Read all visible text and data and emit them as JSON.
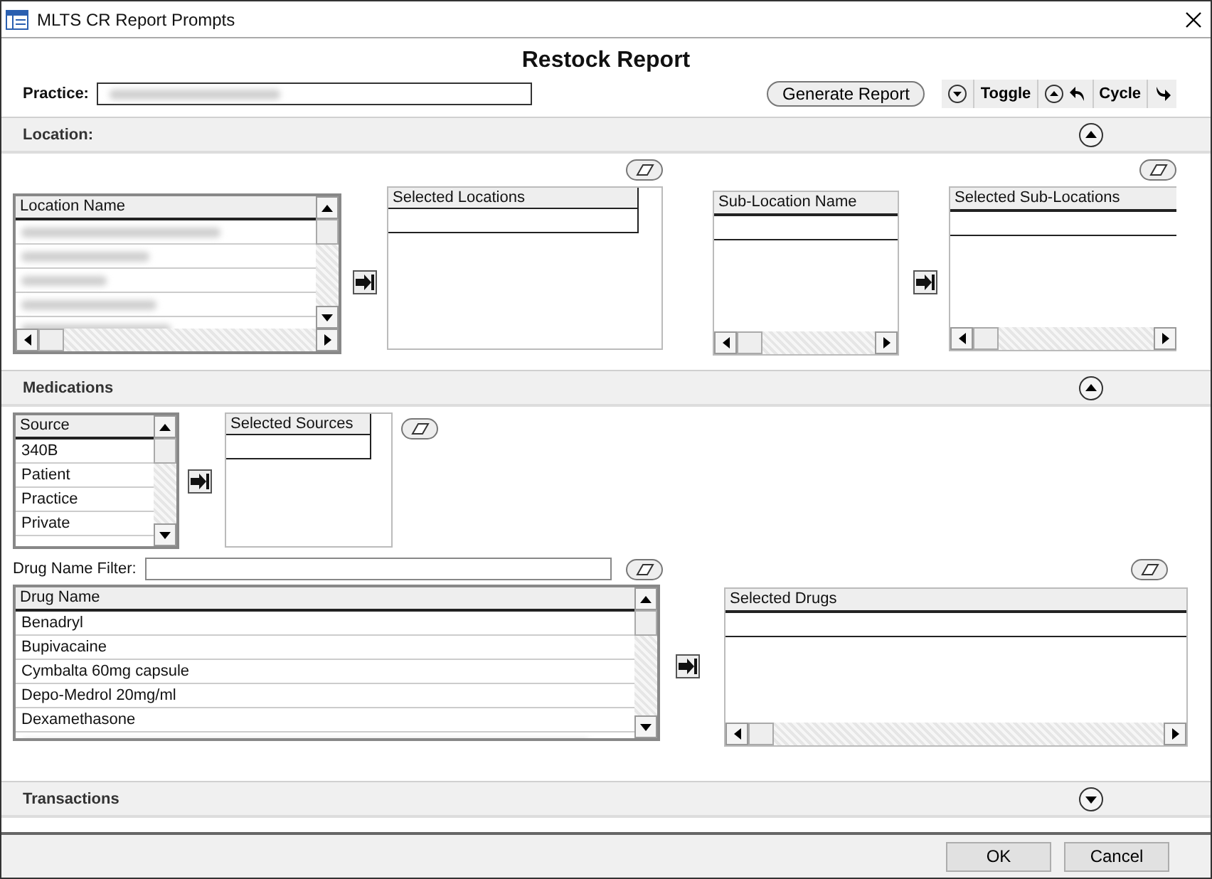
{
  "window": {
    "title": "MLTS CR Report Prompts"
  },
  "report_title": "Restock Report",
  "practice": {
    "label": "Practice:"
  },
  "toolbar": {
    "generate": "Generate Report",
    "toggle": "Toggle",
    "cycle": "Cycle"
  },
  "sections": [
    {
      "title": "Location:",
      "expanded": true
    },
    {
      "title": "Medications",
      "expanded": true
    },
    {
      "title": "Transactions",
      "expanded": false
    }
  ],
  "location": {
    "list_header": "Location Name",
    "selected_header": "Selected Locations",
    "sub_header": "Sub-Location Name",
    "selected_sub_header": "Selected Sub-Locations"
  },
  "medications": {
    "source_header": "Source",
    "sources": [
      "340B",
      "Patient",
      "Practice",
      "Private"
    ],
    "selected_sources_header": "Selected Sources",
    "filter_label": "Drug Name Filter:",
    "drug_header": "Drug Name",
    "drugs": [
      "Benadryl",
      "Bupivacaine",
      "Cymbalta 60mg capsule",
      "Depo-Medrol 20mg/ml",
      "Dexamethasone"
    ],
    "selected_drugs_header": "Selected Drugs"
  },
  "buttons": [
    "OK",
    "Cancel"
  ]
}
